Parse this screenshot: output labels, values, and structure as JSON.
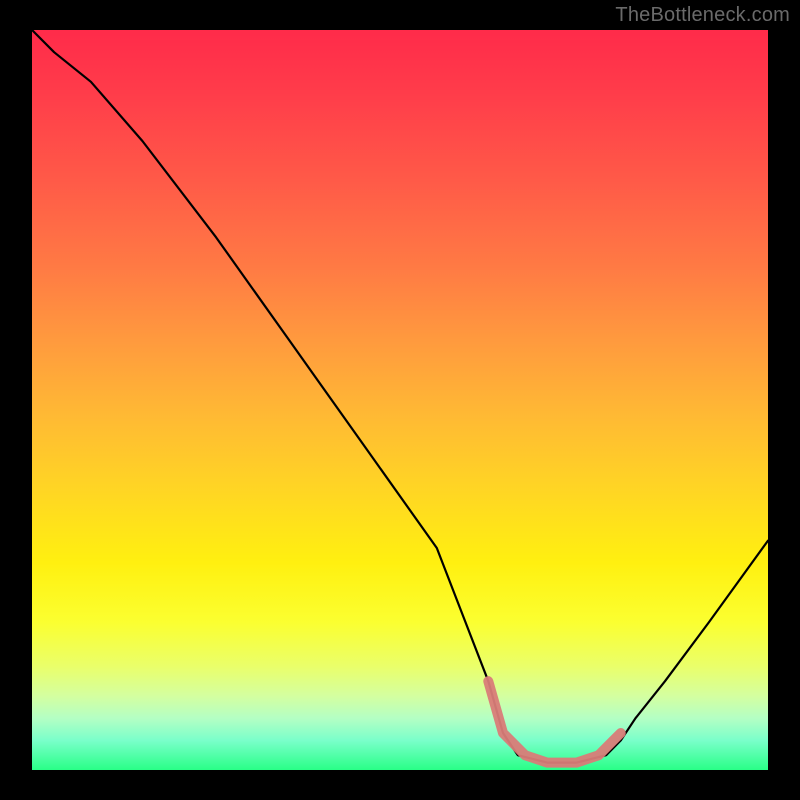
{
  "watermark": "TheBottleneck.com",
  "colors": {
    "background": "#000000",
    "curve": "#000000",
    "highlight": "#d97c78",
    "gradient_top": "#ff2b4a",
    "gradient_bottom": "#29ff87"
  },
  "chart_data": {
    "type": "line",
    "title": "",
    "xlabel": "",
    "ylabel": "",
    "xlim": [
      0,
      100
    ],
    "ylim": [
      0,
      100
    ],
    "series": [
      {
        "name": "bottleneck-curve",
        "x": [
          0,
          3,
          8,
          15,
          25,
          35,
          45,
          55,
          62,
          64,
          66,
          70,
          74,
          78,
          80,
          82,
          86,
          92,
          100
        ],
        "y": [
          100,
          97,
          93,
          85,
          72,
          58,
          44,
          30,
          12,
          5,
          2,
          1,
          1,
          2,
          4,
          7,
          12,
          20,
          31
        ]
      }
    ],
    "highlight_range": {
      "name": "optimal-zone",
      "x": [
        62,
        64,
        67,
        70,
        74,
        77,
        79,
        80
      ],
      "y": [
        12,
        5,
        2,
        1,
        1,
        2,
        4,
        5
      ]
    },
    "annotations": []
  }
}
